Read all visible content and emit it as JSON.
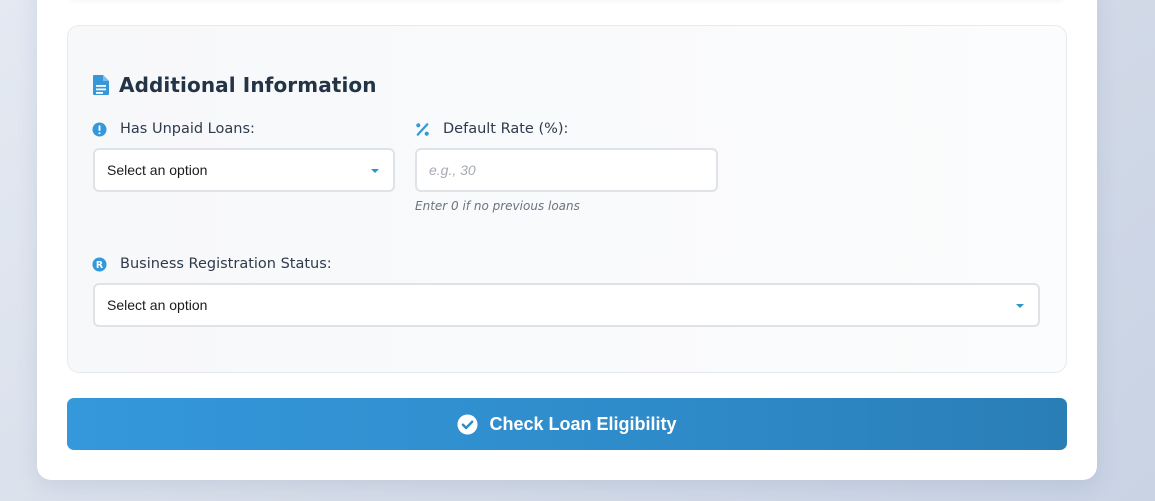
{
  "section": {
    "title": "Additional Information",
    "title_icon": "file-document-icon"
  },
  "fields": {
    "unpaid_loans": {
      "label": "Has Unpaid Loans:",
      "icon": "exclamation-circle-icon",
      "value": "Select an option"
    },
    "default_rate": {
      "label": "Default Rate (%):",
      "icon": "percent-icon",
      "placeholder": "e.g., 30",
      "hint": "Enter 0 if no previous loans"
    },
    "registration_status": {
      "label": "Business Registration Status:",
      "icon": "registered-icon",
      "value": "Select an option"
    }
  },
  "submit": {
    "label": "Check Loan Eligibility",
    "icon": "check-circle-icon"
  },
  "colors": {
    "accent": "#3498db",
    "accent_dark": "#2a7eb6",
    "heading": "#243447"
  }
}
